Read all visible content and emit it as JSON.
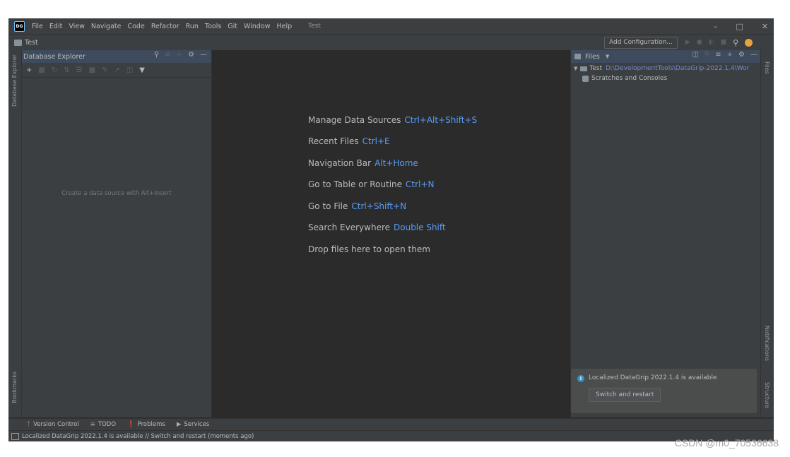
{
  "menu": {
    "items": [
      "File",
      "Edit",
      "View",
      "Navigate",
      "Code",
      "Refactor",
      "Run",
      "Tools",
      "Git",
      "Window",
      "Help"
    ],
    "window_title": "Test"
  },
  "navbar": {
    "project": "Test",
    "add_configuration": "Add Configuration..."
  },
  "db_explorer": {
    "title": "Database Explorer",
    "empty_text": "Create a data source with Alt+Insert"
  },
  "left_stripe": {
    "top_label": "Database Explorer",
    "bottom_label": "Bookmarks"
  },
  "right_stripe": {
    "top_label": "Files",
    "notifications_label": "Notifications",
    "structure_label": "Structure"
  },
  "editor_hints": [
    {
      "label": "Manage Data Sources",
      "key": "Ctrl+Alt+Shift+S"
    },
    {
      "label": "Recent Files",
      "key": "Ctrl+E"
    },
    {
      "label": "Navigation Bar",
      "key": "Alt+Home"
    },
    {
      "label": "Go to Table or Routine",
      "key": "Ctrl+N"
    },
    {
      "label": "Go to File",
      "key": "Ctrl+Shift+N"
    },
    {
      "label": "Search Everywhere",
      "key": "Double Shift"
    },
    {
      "label": "Drop files here to open them",
      "key": ""
    }
  ],
  "files_panel": {
    "title": "Files",
    "root_name": "Test",
    "root_path": "D:\\DevelopmentTools\\DataGrip-2022.1.4\\Wor",
    "scratches": "Scratches and Consoles"
  },
  "notification": {
    "text": "Localized DataGrip 2022.1.4 is available",
    "button": "Switch and restart"
  },
  "bottom_tabs": [
    "Version Control",
    "TODO",
    "Problems",
    "Services"
  ],
  "status": {
    "text": "Localized DataGrip 2022.1.4 is available // Switch and restart (moments ago)"
  },
  "watermark": "CSDN @m0_70536638",
  "colors": {
    "background": "#2b2b2b",
    "panel": "#3c3f41",
    "shortcut": "#589df6",
    "path": "#6f8bd6",
    "info": "#3592c4"
  }
}
